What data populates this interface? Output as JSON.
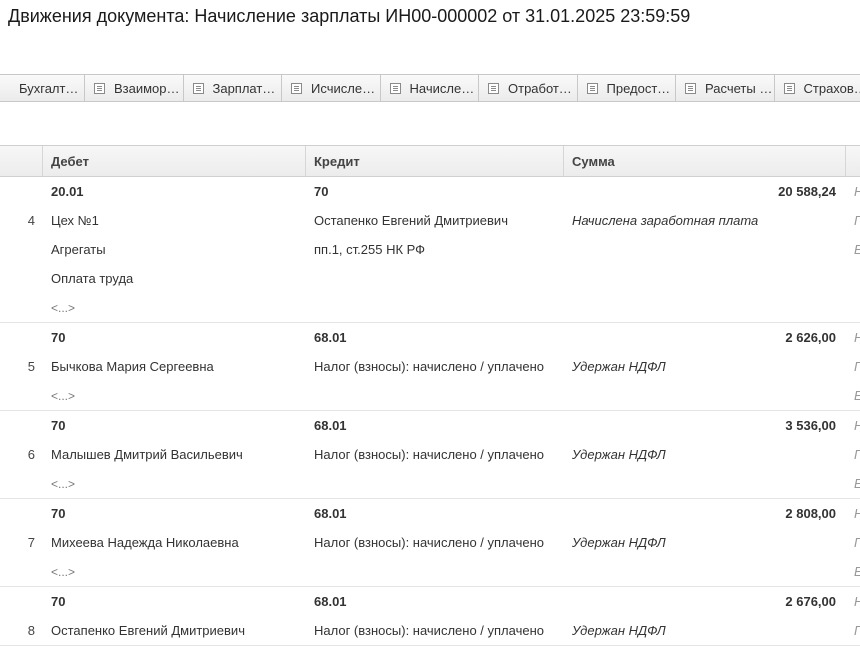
{
  "title": "Движения документа: Начисление зарплаты ИН00-000002 от 31.01.2025 23:59:59",
  "tabs": [
    {
      "label": "Бухгалтерский и налоговый учет"
    },
    {
      "label": "Взаиморасчеты с сотрудниками"
    },
    {
      "label": "Зарплата к выплате"
    },
    {
      "label": "Исчисленный НДФЛ"
    },
    {
      "label": "Начисления сотрудникам"
    },
    {
      "label": "Отработанное время"
    },
    {
      "label": "Предоставленные вычеты"
    },
    {
      "label": "Расчеты с бюджетом"
    },
    {
      "label": "Страховые взносы"
    }
  ],
  "table": {
    "columns": {
      "debit": "Дебет",
      "credit": "Кредит",
      "sum": "Сумма"
    },
    "rows": [
      {
        "num": "4",
        "debit": [
          "20.01",
          "Цех №1",
          "Агрегаты",
          "Оплата труда",
          "<...>"
        ],
        "credit": [
          "70",
          "Остапенко Евгений Дмитриевич",
          "пп.1, ст.255 НК РФ"
        ],
        "amount": "20 588,24",
        "content": "Начислена заработная плата",
        "extra": [
          "Н",
          "Г",
          "Е"
        ]
      },
      {
        "num": "5",
        "debit": [
          "70",
          "Бычкова Мария Сергеевна",
          "<...>"
        ],
        "credit": [
          "68.01",
          "Налог (взносы): начислено / уплачено"
        ],
        "amount": "2 626,00",
        "content": "Удержан НДФЛ",
        "extra": [
          "Н",
          "Г",
          "Е"
        ]
      },
      {
        "num": "6",
        "debit": [
          "70",
          "Малышев Дмитрий Васильевич",
          "<...>"
        ],
        "credit": [
          "68.01",
          "Налог (взносы): начислено / уплачено"
        ],
        "amount": "3 536,00",
        "content": "Удержан НДФЛ",
        "extra": [
          "Н",
          "Г",
          "Е"
        ]
      },
      {
        "num": "7",
        "debit": [
          "70",
          "Михеева Надежда Николаевна",
          "<...>"
        ],
        "credit": [
          "68.01",
          "Налог (взносы): начислено / уплачено"
        ],
        "amount": "2 808,00",
        "content": "Удержан НДФЛ",
        "extra": [
          "Н",
          "Г",
          "Е"
        ]
      },
      {
        "num": "8",
        "debit": [
          "70",
          "Остапенко Евгений Дмитриевич"
        ],
        "credit": [
          "68.01",
          "Налог (взносы): начислено / уплачено"
        ],
        "amount": "2 676,00",
        "content": "Удержан НДФЛ",
        "extra": [
          "Н",
          "Г"
        ]
      }
    ]
  }
}
